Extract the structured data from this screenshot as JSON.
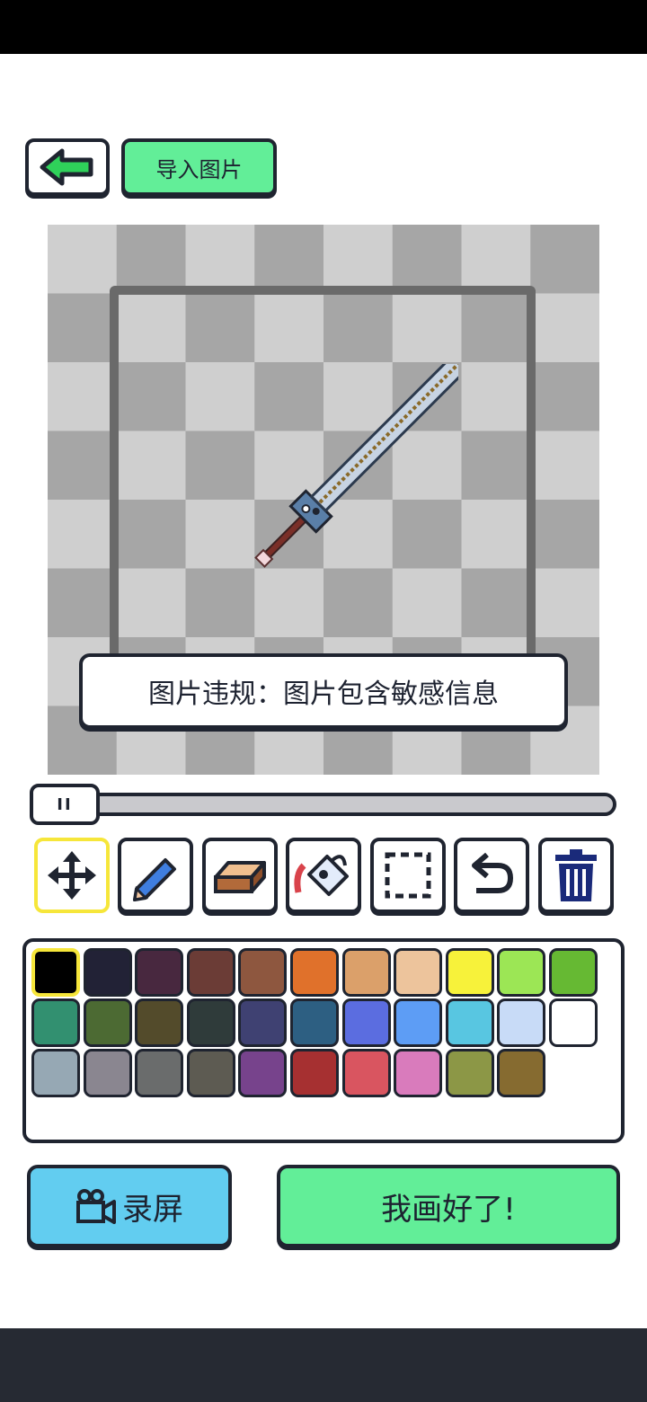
{
  "header": {
    "import_label": "导入图片"
  },
  "canvas": {
    "toast_text": "图片违规：图片包含敏感信息"
  },
  "slider": {
    "thumb_label": "II"
  },
  "tools": [
    {
      "icon": "move-icon"
    },
    {
      "icon": "pencil-icon"
    },
    {
      "icon": "eraser-icon"
    },
    {
      "icon": "paint-bucket-icon"
    },
    {
      "icon": "select-rectangle-icon"
    },
    {
      "icon": "undo-icon"
    },
    {
      "icon": "trash-icon"
    }
  ],
  "palette": {
    "selected_index": 0,
    "colors": [
      "#000000",
      "#222236",
      "#48283f",
      "#6b3c36",
      "#8e573f",
      "#e0712b",
      "#dba06a",
      "#edc49c",
      "#f7f23a",
      "#9ce655",
      "#66b933",
      "#329070",
      "#4c6a33",
      "#534b2b",
      "#2f3b3a",
      "#3f4172",
      "#2d5f82",
      "#5b6de0",
      "#5d9df5",
      "#58c6e1",
      "#c8dbf7",
      "#ffffff",
      "#96a8b4",
      "#8a8690",
      "#6a6c6c",
      "#5d5b52",
      "#77438c",
      "#a63031",
      "#d95560",
      "#d97bbc",
      "#8c9746",
      "#866b30"
    ]
  },
  "bottom": {
    "record_label": "录屏",
    "done_label": "我画好了!"
  }
}
